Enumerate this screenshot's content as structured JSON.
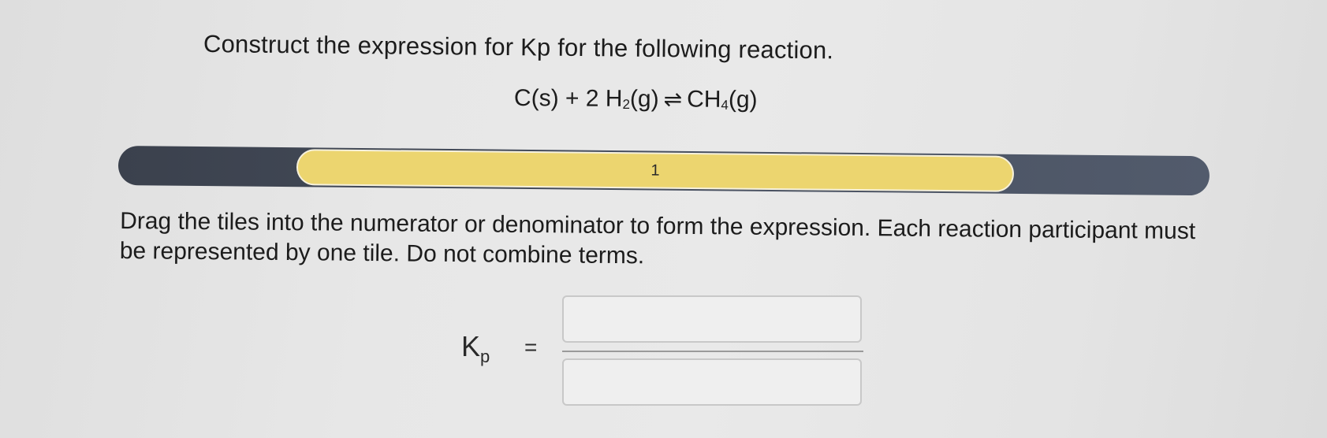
{
  "question": {
    "prompt": "Construct the expression for Kp for the following reaction."
  },
  "reaction": {
    "reactant1": "C(s) + 2 H",
    "reactant1_sub": "2",
    "reactant1_tail": "(g)",
    "arrow": "⇌",
    "product": "CH",
    "product_sub": "4",
    "product_tail": "(g)"
  },
  "progress": {
    "step_label": "1"
  },
  "instructions": {
    "text": "Drag the tiles into the numerator or denominator to form the expression. Each reaction participant must be represented by one tile. Do not combine terms."
  },
  "expression": {
    "k_symbol": "K",
    "k_sub": "p",
    "equals": "="
  },
  "colors": {
    "progress_track": "#4a5262",
    "progress_segment": "#ecd56f"
  }
}
